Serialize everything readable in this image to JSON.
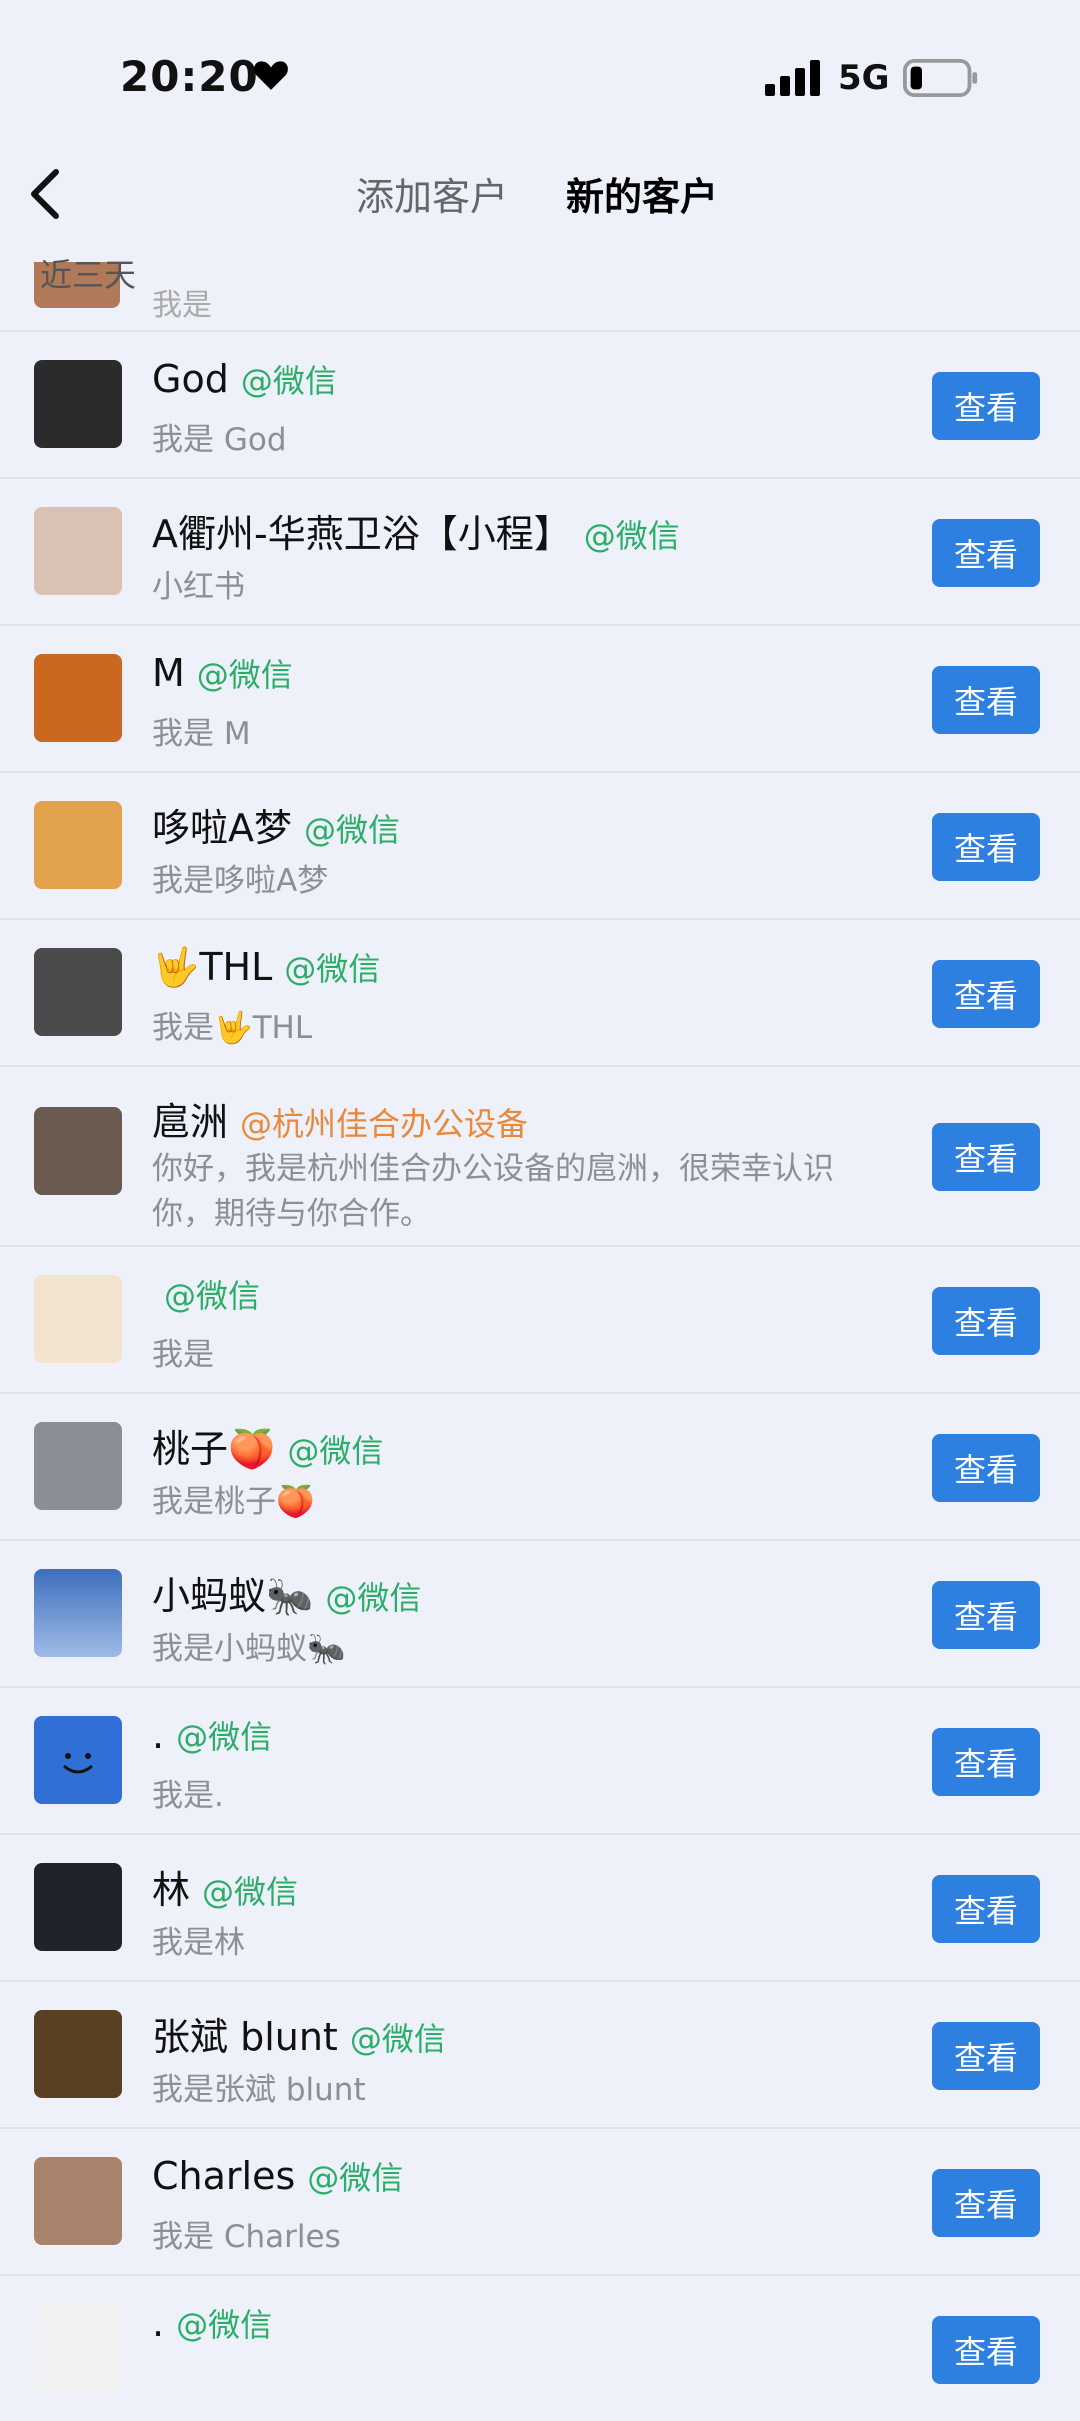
{
  "status": {
    "time": "20:20",
    "network": "5G"
  },
  "header": {
    "tab_add": "添加客户",
    "tab_new": "新的客户"
  },
  "section": {
    "label": "近三天",
    "cut_sub": "我是"
  },
  "button_label": "查看",
  "rows": [
    {
      "name": "God",
      "tag": "@微信",
      "sub": "我是 God",
      "color": "#2b2b2b"
    },
    {
      "name": "A衢州-华燕卫浴【小程】",
      "tag": "@微信",
      "sub": "小红书",
      "color": "#d9c2b3"
    },
    {
      "name": "M",
      "tag": "@微信",
      "sub": "我是 M",
      "color": "#c9681e"
    },
    {
      "name": "哆啦A梦",
      "tag": "@微信",
      "sub": "我是哆啦A梦",
      "color": "#e2a24b"
    },
    {
      "name": "🤟THL",
      "tag": "@微信",
      "sub": "我是🤟THL",
      "color": "#4a4a4a"
    },
    {
      "name": "扈洲",
      "tag": "@杭州佳合办公设备",
      "sub": "你好，我是杭州佳合办公设备的扈洲，很荣幸认识你，期待与你合作。",
      "color": "#6b5a50"
    },
    {
      "name": "",
      "tag": "@微信",
      "sub": "我是",
      "color": "#f3e4cf"
    },
    {
      "name": "桃子🍑",
      "tag": "@微信",
      "sub": "我是桃子🍑",
      "color": "#8b8e96"
    },
    {
      "name": "小蚂蚁🐜",
      "tag": "@微信",
      "sub": "我是小蚂蚁🐜",
      "color": "#5d8bd4"
    },
    {
      "name": ".",
      "tag": "@微信",
      "sub": "我是.",
      "color": "#2f6fd6"
    },
    {
      "name": "林",
      "tag": "@微信",
      "sub": "我是林",
      "color": "#1e232c"
    },
    {
      "name": "张斌 blunt",
      "tag": "@微信",
      "sub": "我是张斌 blunt",
      "color": "#5a4022"
    },
    {
      "name": "Charles",
      "tag": "@微信",
      "sub": "我是 Charles",
      "color": "#a8826b"
    },
    {
      "name": ".",
      "tag": "@微信",
      "sub": "",
      "color": "#f2f2f2"
    }
  ]
}
